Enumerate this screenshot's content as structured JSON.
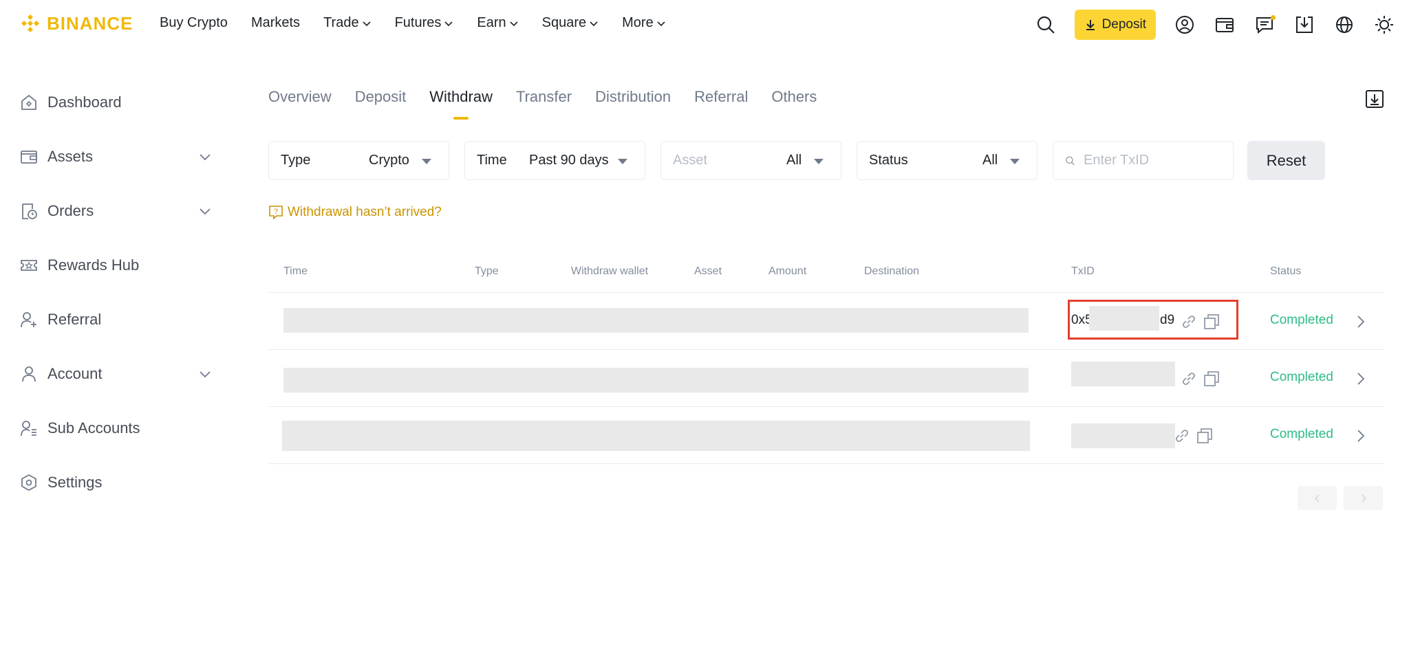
{
  "brand": {
    "name": "BINANCE",
    "color": "#f0b90b"
  },
  "nav": {
    "items": [
      {
        "label": "Buy Crypto",
        "has_dropdown": false
      },
      {
        "label": "Markets",
        "has_dropdown": false
      },
      {
        "label": "Trade",
        "has_dropdown": true
      },
      {
        "label": "Futures",
        "has_dropdown": true
      },
      {
        "label": "Earn",
        "has_dropdown": true
      },
      {
        "label": "Square",
        "has_dropdown": true
      },
      {
        "label": "More",
        "has_dropdown": true
      }
    ],
    "deposit_label": "Deposit",
    "right_icons": [
      "search-icon",
      "download-arrow-icon",
      "profile-icon",
      "wallet-icon",
      "message-icon",
      "download-app-icon",
      "globe-icon",
      "theme-sun-icon"
    ]
  },
  "sidebar": {
    "items": [
      {
        "label": "Dashboard",
        "icon": "home-icon",
        "expandable": false
      },
      {
        "label": "Assets",
        "icon": "wallet-icon",
        "expandable": true
      },
      {
        "label": "Orders",
        "icon": "orders-icon",
        "expandable": true
      },
      {
        "label": "Rewards Hub",
        "icon": "ticket-icon",
        "expandable": false
      },
      {
        "label": "Referral",
        "icon": "add-user-icon",
        "expandable": false
      },
      {
        "label": "Account",
        "icon": "user-icon",
        "expandable": true
      },
      {
        "label": "Sub Accounts",
        "icon": "user-list-icon",
        "expandable": false
      },
      {
        "label": "Settings",
        "icon": "settings-hex-icon",
        "expandable": false
      }
    ]
  },
  "tabs": [
    "Overview",
    "Deposit",
    "Withdraw",
    "Transfer",
    "Distribution",
    "Referral",
    "Others"
  ],
  "active_tab": "Withdraw",
  "filters": {
    "type": {
      "label": "Type",
      "value": "Crypto"
    },
    "time": {
      "label": "Time",
      "value": "Past 90 days"
    },
    "asset": {
      "label": "Asset",
      "value": "All"
    },
    "status": {
      "label": "Status",
      "value": "All"
    },
    "txid_placeholder": "Enter TxID",
    "reset_label": "Reset"
  },
  "help_link": "Withdrawal hasn’t arrived?",
  "table": {
    "headers": [
      "Time",
      "Type",
      "Withdraw wallet",
      "Asset",
      "Amount",
      "Destination",
      "TxID",
      "Status"
    ],
    "rows": [
      {
        "txid_prefix": "0x5",
        "txid_suffix": "d9",
        "status": "Completed"
      },
      {
        "txid_prefix": "",
        "txid_suffix": "",
        "status": "Completed"
      },
      {
        "txid_prefix": "",
        "txid_suffix": "",
        "status": "Completed"
      }
    ]
  },
  "colors": {
    "accent": "#fcd535",
    "status_completed": "#2ebd85",
    "highlight": "#e53e2e",
    "link": "#c99400"
  }
}
